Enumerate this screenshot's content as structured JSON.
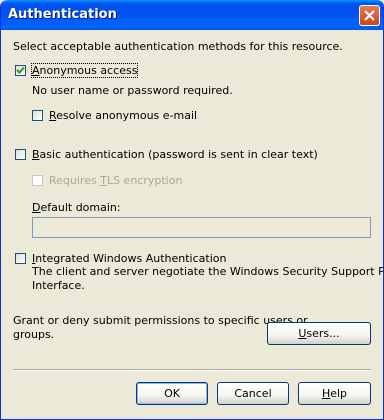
{
  "window": {
    "title": "Authentication"
  },
  "intro": "Select acceptable authentication methods for this resource.",
  "anonymous": {
    "label_access_key": "A",
    "label_rest": "nonymous access",
    "checked": true,
    "note": "No user name or password required.",
    "resolve": {
      "label_prefix": "R",
      "label_rest": "esolve anonymous e-mail",
      "checked": false
    }
  },
  "basic": {
    "label_access_key": "B",
    "label_rest": "asic authentication (password is sent in clear text)",
    "checked": false,
    "tls": {
      "label_prefix": "Requires ",
      "label_key": "T",
      "label_rest": "LS encryption",
      "checked": false,
      "enabled": false
    },
    "domain_label_prefix": "D",
    "domain_label_rest": "efault domain:",
    "domain_value": ""
  },
  "integrated": {
    "label_access_key": "I",
    "label_rest": "ntegrated Windows Authentication",
    "checked": false,
    "description_line1": "The client and server negotiate the Windows Security Support Provider",
    "description_line2": "Interface."
  },
  "permissions": {
    "text_line1": "Grant or deny submit permissions to specific users or",
    "text_line2": "groups.",
    "users_key": "U",
    "users_rest": "sers..."
  },
  "footer": {
    "ok_label": "OK",
    "cancel_label": "Cancel",
    "help_key": "H",
    "help_rest": "elp"
  }
}
